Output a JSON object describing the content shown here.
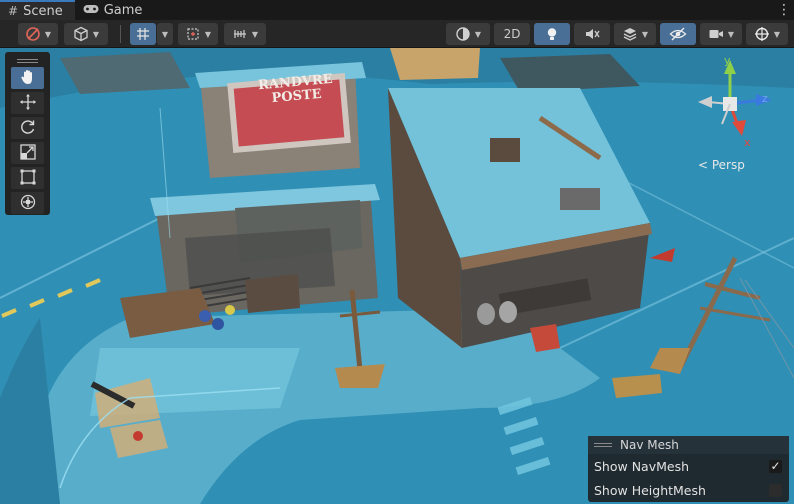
{
  "tabs": [
    {
      "label": "Scene",
      "icon": "grid-icon",
      "active": true
    },
    {
      "label": "Game",
      "icon": "gamepad-icon",
      "active": false
    }
  ],
  "toolbar": {
    "mode_2d_label": "2D"
  },
  "gizmo": {
    "axis_x": "x",
    "axis_y": "y",
    "axis_z": "z",
    "projection_label": "< Persp"
  },
  "navmesh_overlay": {
    "title": "Nav Mesh",
    "options": [
      {
        "label": "Show NavMesh",
        "checked": true
      },
      {
        "label": "Show HeightMesh",
        "checked": false
      }
    ]
  },
  "billboard": {
    "text_line1": "RANDVRE",
    "text_line2": "POSTE"
  },
  "colors": {
    "navmesh_blue": "#2f8fb5",
    "active_blue": "#4a6f96",
    "axis_x": "#e04a3a",
    "axis_y": "#8fd04a",
    "axis_z": "#3a7ae0"
  }
}
